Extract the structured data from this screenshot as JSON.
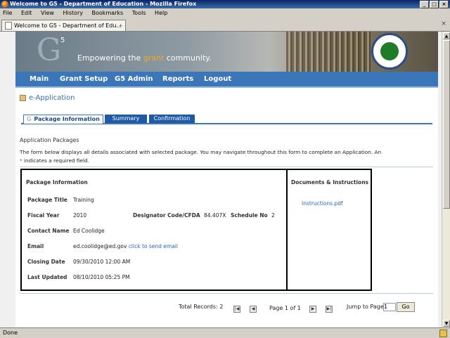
{
  "window": {
    "title": "Welcome to G5 - Department of Education - Mozilla Firefox",
    "minimize": "_",
    "maximize": "□",
    "close": "×"
  },
  "menu": [
    "File",
    "Edit",
    "View",
    "History",
    "Bookmarks",
    "Tools",
    "Help"
  ],
  "browser_tab": {
    "label": "Welcome to G5 - Department of Edu...",
    "close": "×",
    "new_tab": "+"
  },
  "banner": {
    "logo_letter": "G",
    "logo_sup": "5",
    "tagline_pre": "Empowering the ",
    "tagline_highlight": "grant",
    "tagline_post": " community."
  },
  "nav": [
    "Main",
    "Grant Setup",
    "G5 Admin",
    "Reports",
    "Logout"
  ],
  "page_title": "e-Application",
  "tabs": {
    "active": "Package Information",
    "others": [
      "Summary",
      "Confirmation"
    ],
    "active_marker": "G"
  },
  "section_title": "Application Packages",
  "description": {
    "text": "The form below displays all details associated with selected package. You may navigate throughout this form to complete an Application. An ",
    "star": "*",
    "text2": " indicates a required field."
  },
  "package": {
    "heading": "Package Information",
    "title_label": "Package Title",
    "title_value": "Training",
    "fiscal_label": "Fiscal Year",
    "fiscal_value": "2010",
    "cfda_label": "Designator Code/CFDA",
    "cfda_value": "84.407X",
    "schedule_label": "Schedule No",
    "schedule_value": "2",
    "contact_label": "Contact Name",
    "contact_value": "Ed Coolidge",
    "email_label": "Email",
    "email_value": "ed.coolidge@ed.gov",
    "email_link": "click to send email",
    "closing_label": "Closing Date",
    "closing_value": "09/30/2010 12:00 AM",
    "updated_label": "Last Updated",
    "updated_value": "08/10/2010 05:25 PM"
  },
  "documents": {
    "heading": "Documents & Instructions",
    "file": "Instructions.pdf"
  },
  "pager": {
    "total": "Total Records: 2",
    "page": "Page 1 of 1",
    "jump_label": "Jump to Page",
    "jump_value": "1",
    "go": "Go",
    "first": "|◀",
    "prev": "◀",
    "next": "▶",
    "last": "▶|"
  },
  "status": "Done"
}
